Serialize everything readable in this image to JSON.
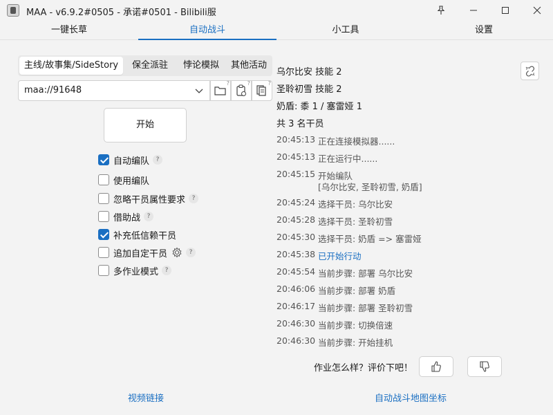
{
  "window": {
    "title": "MAA - v6.9.2#0505 - 承诺#0501 - Bilibili服",
    "icons": [
      "pin-icon",
      "minimize-icon",
      "maximize-icon",
      "close-icon"
    ]
  },
  "main_tabs": [
    {
      "label": "一键长草"
    },
    {
      "label": "自动战斗"
    },
    {
      "label": "小工具"
    },
    {
      "label": "设置"
    }
  ],
  "sub_tabs": [
    {
      "label": "主线/故事集/SideStory"
    },
    {
      "label": "保全派驻"
    },
    {
      "label": "悖论模拟"
    },
    {
      "label": "其他活动"
    }
  ],
  "file_input": {
    "value": "maa://91648"
  },
  "start_button": {
    "label": "开始"
  },
  "options": [
    {
      "label": "自动编队",
      "checked": true,
      "help": "?"
    },
    {
      "label": "使用编队",
      "checked": false
    },
    {
      "label": "忽略干员属性要求",
      "checked": false,
      "help": "?"
    },
    {
      "label": "借助战",
      "checked": false,
      "help": "?"
    },
    {
      "label": "补充低信赖干员",
      "checked": true
    },
    {
      "label": "追加自定干员",
      "checked": false,
      "help": "?"
    },
    {
      "label": "多作业模式",
      "checked": false,
      "help": "?"
    }
  ],
  "team": [
    "乌尔比安 技能 2",
    "圣聆初雪 技能 2",
    "奶盾: 黍 1 / 塞雷娅 1",
    "共 3 名干员"
  ],
  "log": [
    {
      "time": "20:45:13",
      "msg": "正在连接模拟器......"
    },
    {
      "time": "20:45:13",
      "msg": "正在运行中......"
    },
    {
      "time": "20:45:15",
      "msg": "开始编队",
      "msg2": "[乌尔比安, 圣聆初雪, 奶盾]"
    },
    {
      "time": "20:45:24",
      "msg": "选择干员: 乌尔比安"
    },
    {
      "time": "20:45:28",
      "msg": "选择干员: 圣聆初雪"
    },
    {
      "time": "20:45:30",
      "msg": "选择干员: 奶盾 => 塞雷娅"
    },
    {
      "time": "20:45:38",
      "msg": "已开始行动",
      "highlight": true
    },
    {
      "time": "20:45:54",
      "msg": "当前步骤: 部署 乌尔比安"
    },
    {
      "time": "20:46:06",
      "msg": "当前步骤: 部署 奶盾"
    },
    {
      "time": "20:46:17",
      "msg": "当前步骤: 部署 圣聆初雪"
    },
    {
      "time": "20:46:30",
      "msg": "当前步骤: 切换倍速"
    },
    {
      "time": "20:46:30",
      "msg": "当前步骤: 开始挂机"
    }
  ],
  "feedback": {
    "label": "作业怎么样？评价下吧！"
  },
  "links": {
    "video": "视频链接",
    "map_coords": "自动战斗地图坐标"
  },
  "colors": {
    "accent": "#1a6fc2"
  }
}
